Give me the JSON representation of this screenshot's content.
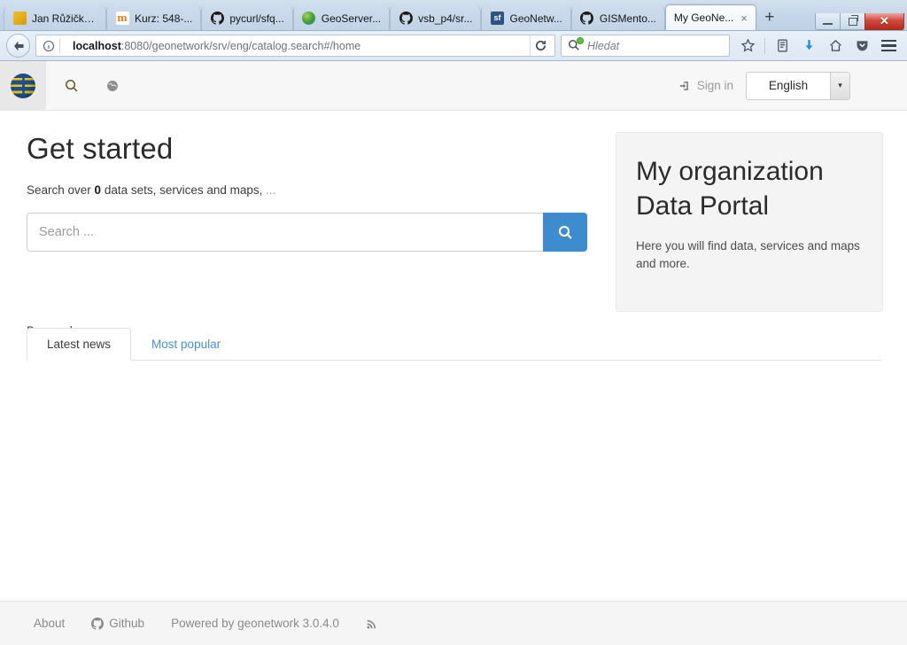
{
  "browser": {
    "tabs": [
      {
        "label": "Jan Růžička - s...",
        "icon": "window-favicon",
        "active": false
      },
      {
        "label": "Kurz: 548-...",
        "icon": "moodle-favicon",
        "active": false
      },
      {
        "label": "pycurl/sfq...",
        "icon": "github-favicon",
        "active": false
      },
      {
        "label": "GeoServer...",
        "icon": "geoserver-favicon",
        "active": false
      },
      {
        "label": "vsb_p4/sr...",
        "icon": "github-favicon",
        "active": false
      },
      {
        "label": "GeoNetw...",
        "icon": "sourceforge-favicon",
        "active": false
      },
      {
        "label": "GISMento...",
        "icon": "github-favicon",
        "active": false
      },
      {
        "label": "My GeoNe...",
        "icon": "geonetwork-favicon",
        "active": true
      }
    ],
    "new_tab_label": "+",
    "close_tab_label": "×",
    "window_controls": {
      "minimize": "",
      "restore": "",
      "close": "✕"
    },
    "url": {
      "host": "localhost",
      "rest": ":8080/geonetwork/srv/eng/catalog.search#/home"
    },
    "search_placeholder": "Hledat",
    "toolbar_icons": [
      "bookmark-star-icon",
      "library-icon",
      "downloads-icon",
      "home-icon",
      "pocket-icon",
      "menu-icon"
    ]
  },
  "header": {
    "logo_name": "geonetwork-globe-logo",
    "nav": [
      {
        "name": "search-nav-icon",
        "label": "Search"
      },
      {
        "name": "map-nav-icon",
        "label": "Map"
      }
    ],
    "sign_in_label": "Sign in",
    "language": {
      "value": "English",
      "arrow": "▾"
    }
  },
  "main": {
    "title": "Get started",
    "subtitle_prefix": "Search over ",
    "subtitle_count": "0",
    "subtitle_suffix": " data sets, services and maps, ",
    "subtitle_dots": "...",
    "search": {
      "placeholder": "Search ...",
      "value": "",
      "button_icon": "search-icon"
    },
    "browse_label": "Browse by",
    "tabs": [
      {
        "label": "Latest news",
        "active": true
      },
      {
        "label": "Most popular",
        "active": false
      }
    ]
  },
  "aside": {
    "title_line1": "My organization",
    "title_line2": "Data Portal",
    "text": "Here you will find data, services and maps and more."
  },
  "footer": {
    "items": [
      {
        "label": "About",
        "icon": null
      },
      {
        "label": "Github",
        "icon": "github-icon"
      },
      {
        "label": "Powered by geonetwork 3.0.4.0",
        "icon": null
      }
    ],
    "rss_icon": "rss-icon"
  },
  "colors": {
    "accent_blue": "#3d8dce",
    "link_blue": "#4a8fd4",
    "chrome_blue": "#d3e1ef",
    "close_red": "#cf4a3d",
    "logo_blue": "#1d4f8f",
    "logo_yellow": "#e8c41e"
  }
}
